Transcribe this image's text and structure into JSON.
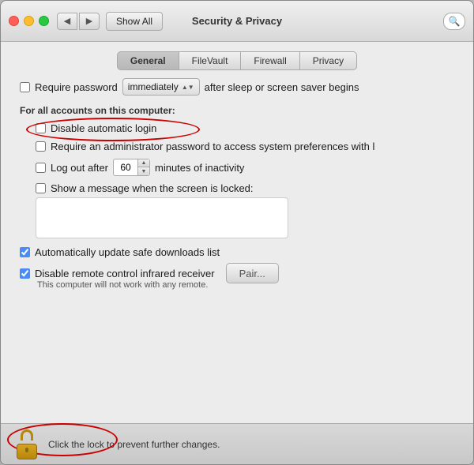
{
  "window": {
    "title": "Security & Privacy"
  },
  "titlebar": {
    "show_all": "Show All"
  },
  "tabs": [
    {
      "label": "General",
      "active": true
    },
    {
      "label": "FileVault",
      "active": false
    },
    {
      "label": "Firewall",
      "active": false
    },
    {
      "label": "Privacy",
      "active": false
    }
  ],
  "general": {
    "section_accounts": "For all accounts on this computer:",
    "require_password_label": "Require password",
    "require_password_dropdown": "immediately",
    "require_password_suffix": "after sleep or screen saver begins",
    "disable_autologin": "Disable automatic login",
    "require_admin": "Require an administrator password to access system preferences with l",
    "logout_after": "Log out after",
    "logout_minutes": "60",
    "logout_suffix": "minutes of inactivity",
    "show_message": "Show a message when the screen is locked:",
    "auto_update": "Automatically update safe downloads list",
    "disable_remote": "Disable remote control infrared receiver",
    "remote_subtext": "This computer will not work with any remote.",
    "pair_button": "Pair..."
  },
  "bottom": {
    "lock_text": "Click the lock to prevent further changes."
  }
}
